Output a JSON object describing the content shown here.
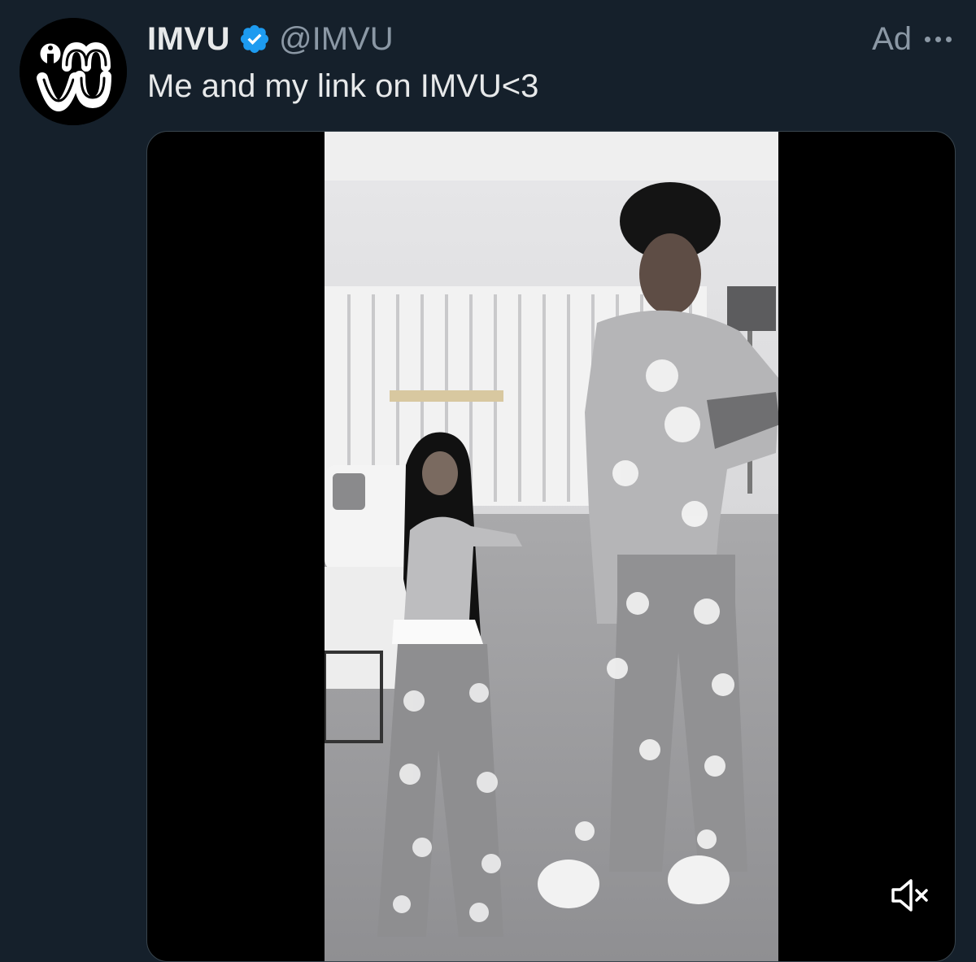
{
  "tweet": {
    "account": {
      "name": "IMVU",
      "handle": "@IMVU",
      "verified": true,
      "avatar_icon": "imvu-logo-icon"
    },
    "ad_label": "Ad",
    "more_icon": "more-options-icon",
    "text": "Me and my link on IMVU<3",
    "media": {
      "type": "video",
      "muted": true,
      "mute_icon": "speaker-muted-icon"
    }
  },
  "colors": {
    "background": "#15202b",
    "text_primary": "#e7e9ea",
    "text_secondary": "#8b98a5",
    "verified_badge": "#1d9bf0"
  }
}
